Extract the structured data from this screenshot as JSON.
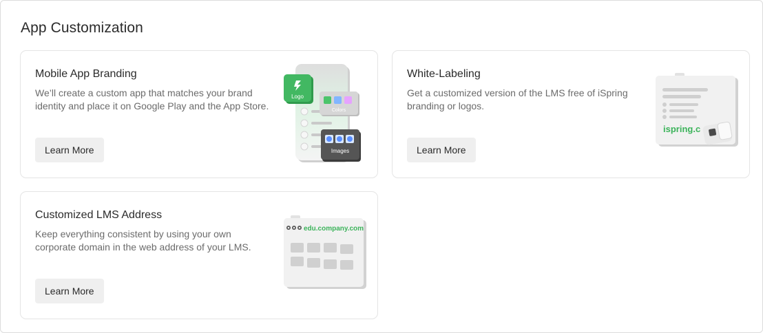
{
  "page": {
    "title": "App Customization"
  },
  "cards": [
    {
      "title": "Mobile App Branding",
      "description": "We’ll create a custom app that matches your brand identity and place it on Google Play and the App Store.",
      "button": "Learn More",
      "illustration": {
        "icon": "mobile-branding-illustration",
        "labels": [
          "Logo",
          "Colors",
          "Images"
        ]
      }
    },
    {
      "title": "White-Labeling",
      "description": "Get a customized version of the LMS free of iSpring branding or logos.",
      "button": "Learn More",
      "illustration": {
        "icon": "white-label-illustration",
        "brand_text": "ispring.c"
      }
    },
    {
      "title": "Customized LMS Address",
      "description": "Keep everything consistent by using your own corporate domain in the web address of your LMS.",
      "button": "Learn More",
      "illustration": {
        "icon": "custom-domain-illustration",
        "domain_text": "edu.company.com"
      }
    }
  ],
  "colors": {
    "accent_green": "#3bb35a",
    "button_bg": "#efefef",
    "border": "#e4e4e4"
  }
}
